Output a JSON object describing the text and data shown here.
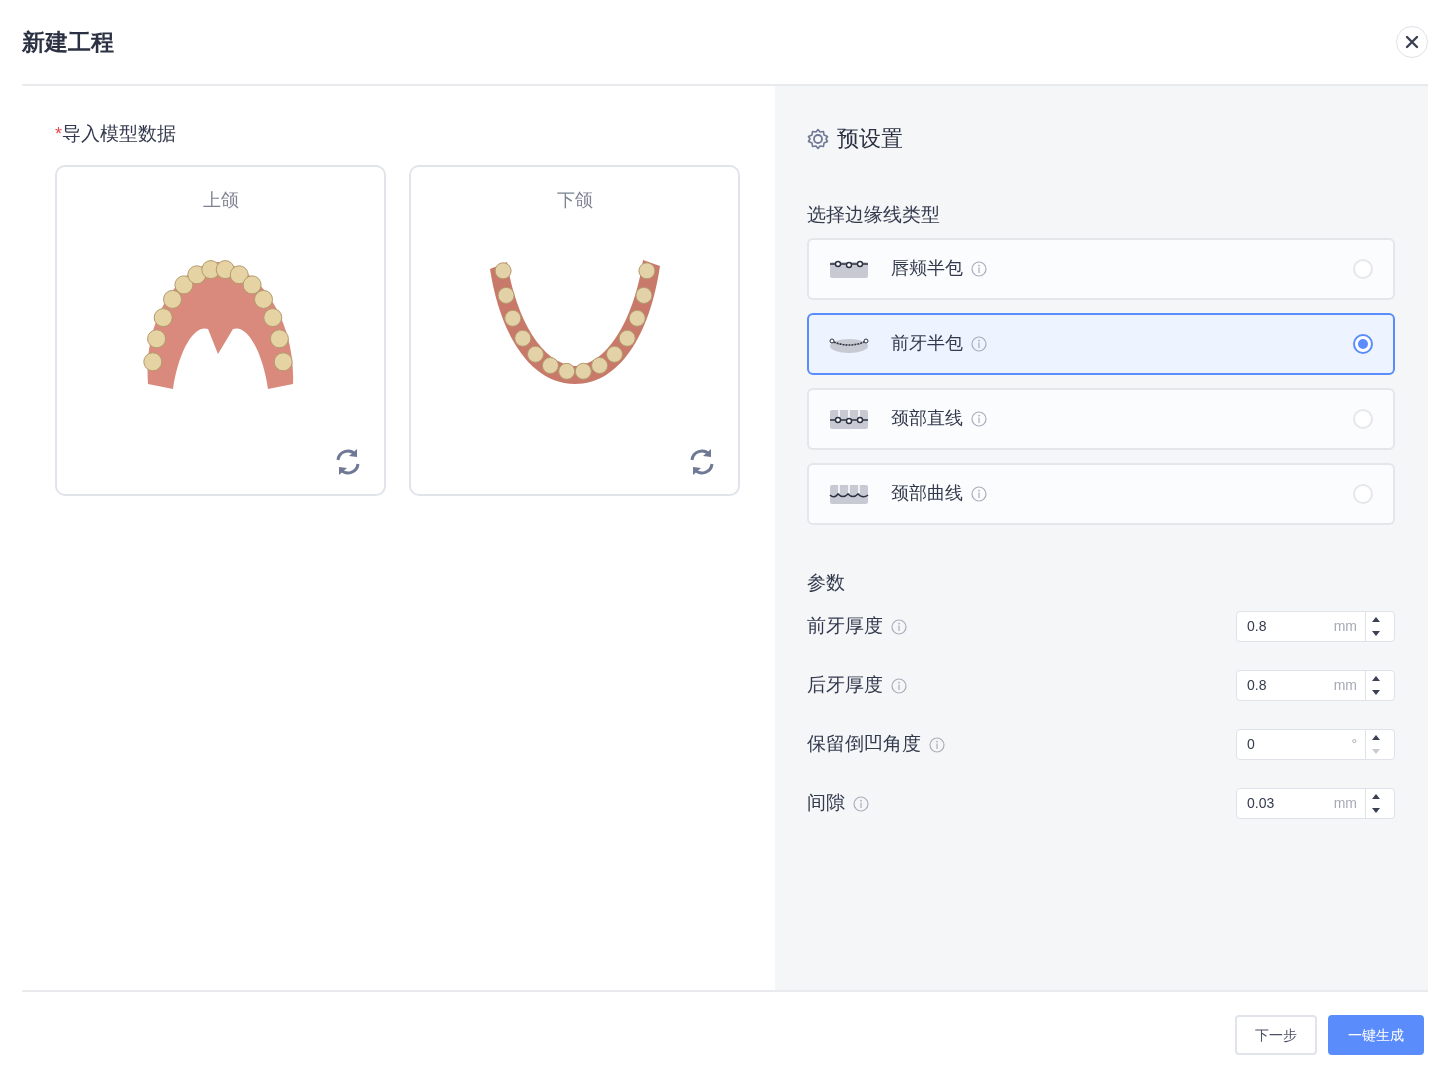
{
  "dialog": {
    "title": "新建工程"
  },
  "import": {
    "required_mark": "*",
    "title": "导入模型数据",
    "models": [
      {
        "label": "上颌",
        "kind": "upper"
      },
      {
        "label": "下颌",
        "kind": "lower"
      }
    ]
  },
  "presets": {
    "title": "预设置",
    "edge_section": "选择边缘线类型",
    "edge_types": [
      {
        "label": "唇颊半包",
        "kind": "labial",
        "selected": false
      },
      {
        "label": "前牙半包",
        "kind": "anterior",
        "selected": true
      },
      {
        "label": "颈部直线",
        "kind": "cervical_straight",
        "selected": false
      },
      {
        "label": "颈部曲线",
        "kind": "cervical_curve",
        "selected": false
      }
    ],
    "params_section": "参数",
    "params": [
      {
        "label": "前牙厚度",
        "value": "0.8",
        "unit": "mm",
        "down_disabled": false
      },
      {
        "label": "后牙厚度",
        "value": "0.8",
        "unit": "mm",
        "down_disabled": false
      },
      {
        "label": "保留倒凹角度",
        "value": "0",
        "unit": "°",
        "down_disabled": true
      },
      {
        "label": "间隙",
        "value": "0.03",
        "unit": "mm",
        "down_disabled": false
      }
    ]
  },
  "buttons": [
    {
      "label": "下一步",
      "kind": "secondary"
    },
    {
      "label": "一键生成",
      "kind": "primary"
    }
  ]
}
